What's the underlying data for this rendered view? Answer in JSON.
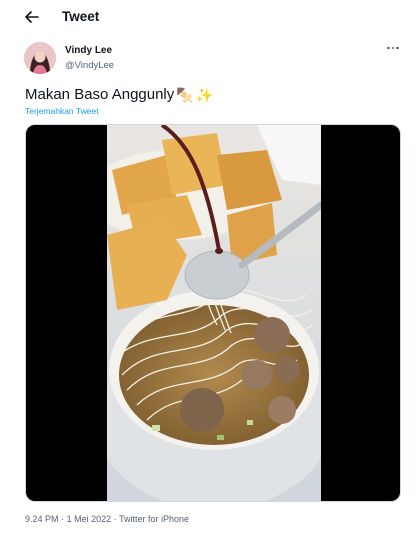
{
  "header": {
    "title": "Tweet",
    "back_icon": "arrow-left-icon"
  },
  "author": {
    "display_name": "Vindy Lee",
    "handle": "@VindyLee",
    "more_icon": "more-horizontal-icon"
  },
  "tweet": {
    "text": "Makan Baso Anggunly",
    "emojis": [
      "🍢",
      "✨"
    ],
    "translate_label": "Terjemahkan Tweet"
  },
  "media": {
    "kind": "video",
    "alt_icon": "food-photo"
  },
  "meta": {
    "time": "9.24 PM",
    "separator1": "·",
    "date": "1 Mei 2022",
    "separator2": "·",
    "source": "Twitter for iPhone"
  },
  "colors": {
    "link": "#1d9bf0",
    "secondary": "#536471",
    "text": "#0f1419"
  }
}
